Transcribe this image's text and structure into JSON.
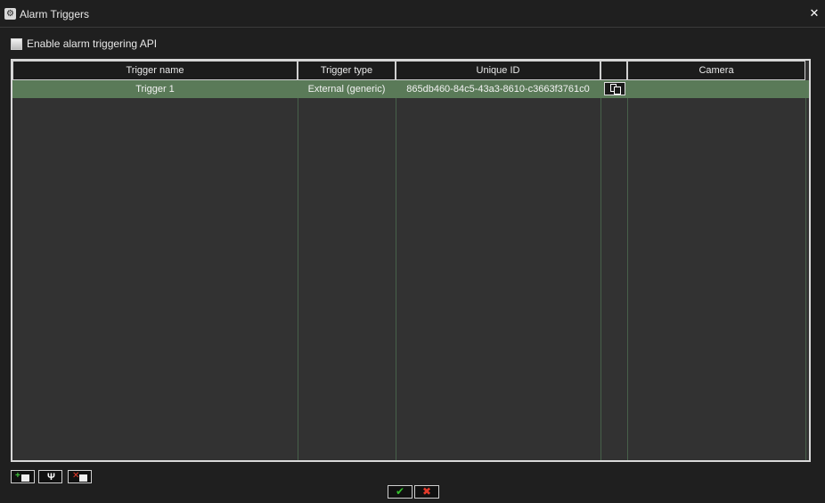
{
  "window": {
    "title": "Alarm Triggers",
    "close_glyph": "✕"
  },
  "api": {
    "label": "Enable alarm triggering API",
    "checked": false
  },
  "table": {
    "columns": [
      "Trigger name",
      "Trigger type",
      "Unique ID",
      "",
      "Camera"
    ],
    "rows": [
      {
        "name": "Trigger 1",
        "type": "External (generic)",
        "id": "865db460-84c5-43a3-8610-c3663f3761c0",
        "camera": ""
      }
    ],
    "selected_row_color": "#5a7a58",
    "grid_line_color": "#47614a"
  },
  "toolbar": {
    "add_icon": "add-trigger-icon",
    "edit_icon": "wrench-icon",
    "delete_icon": "delete-trigger-icon"
  },
  "dialog": {
    "ok_glyph": "✔",
    "cancel_glyph": "✖"
  }
}
